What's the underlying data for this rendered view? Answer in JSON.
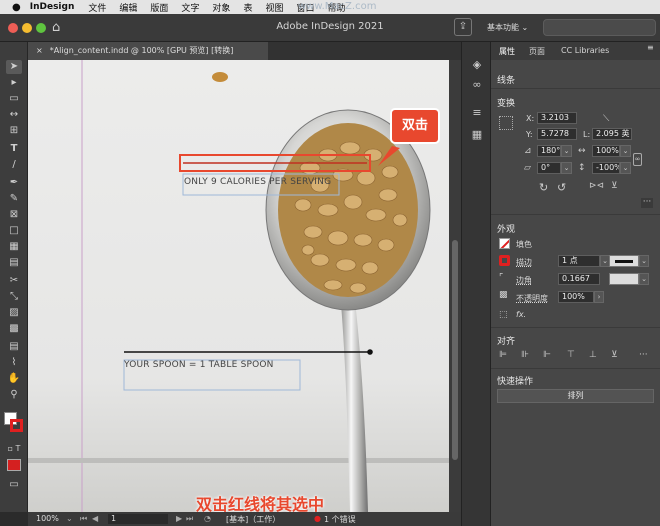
{
  "menubar": {
    "app": "InDesign",
    "items": [
      "文件",
      "编辑",
      "版面",
      "文字",
      "对象",
      "表",
      "视图",
      "窗口",
      "帮助"
    ],
    "watermark": "www.MacZ.com"
  },
  "window": {
    "title": "Adobe InDesign 2021",
    "workspace": "基本功能"
  },
  "document_tab": {
    "close": "×",
    "label": "*Align_content.indd @ 100% [GPU 预览] [转换]"
  },
  "canvas": {
    "text1": "ONLY 9 CALORIES PER SERVING",
    "text2": "YOUR SPOON = 1 TABLE SPOON",
    "callout": "双击",
    "caption": "双击红线将其选中"
  },
  "statusbar": {
    "zoom": "100%",
    "page": "1",
    "style": "[基本]（工作）",
    "errors": "1 个错误"
  },
  "panel": {
    "tabs": [
      "属性",
      "页面",
      "CC Libraries"
    ],
    "section_line": "线条",
    "section_transform": "变换",
    "x_label": "X:",
    "x_value": "3.2103",
    "y_label": "Y:",
    "y_value": "5.7278",
    "l_label": "L:",
    "l_value": "2.095 英",
    "rotation": "180°",
    "scale_x": "100%",
    "shear": "0°",
    "scale_y": "-100%",
    "section_appearance": "外观",
    "fill_label": "填色",
    "stroke_label": "描边",
    "stroke_weight": "1 点",
    "corner_label": "边角",
    "corner_value": "0.1667",
    "opacity_label": "不透明度",
    "opacity_value": "100%",
    "fx_label": "fx.",
    "section_align": "对齐",
    "section_quick": "快速操作",
    "arrange_button": "排列"
  },
  "colors": {
    "accent_red": "#e8482e",
    "selection": "#c03020"
  }
}
